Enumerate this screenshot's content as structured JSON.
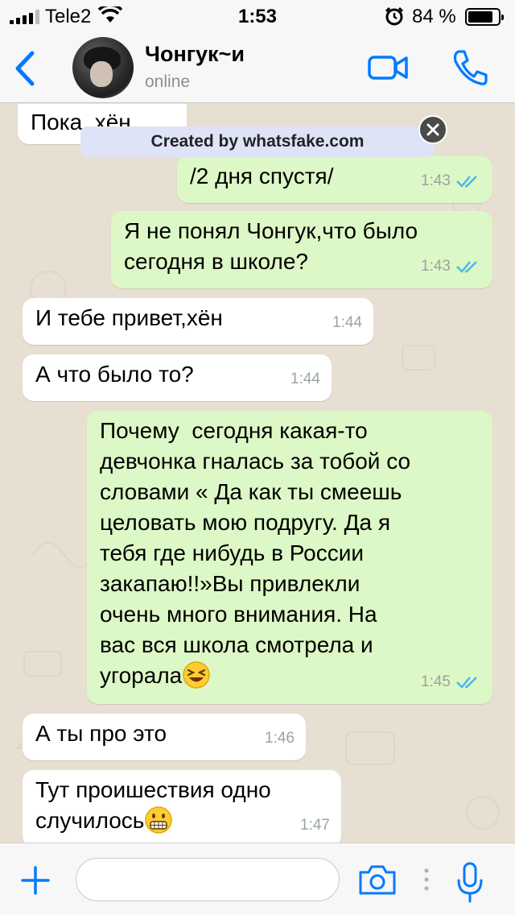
{
  "status_bar": {
    "carrier": "Tele2",
    "time": "1:53",
    "battery": "84 %",
    "battery_level": 0.84
  },
  "header": {
    "contact_name": "Чонгук~и",
    "status": "online",
    "icons": [
      "back-arrow-icon",
      "video-call-icon",
      "phone-icon"
    ]
  },
  "watermark": "Created by whatsfake.com",
  "messages": [
    {
      "dir": "in",
      "text": "Пока, хён",
      "time": ""
    },
    {
      "dir": "out",
      "text": "/2 дня спустя/",
      "time": "1:43",
      "read": true
    },
    {
      "dir": "out",
      "text": "Я не понял Чонгук,что было\nсегодня в школе?",
      "time": "1:43",
      "read": true
    },
    {
      "dir": "in",
      "text": "И тебе привет,хён",
      "time": "1:44"
    },
    {
      "dir": "in",
      "text": "А что было то?",
      "time": "1:44"
    },
    {
      "dir": "out",
      "text": "Почему  сегодня какая-то\nдевчонка гналась за тобой со\nсловами « Да как ты смеешь\nцеловать мою подругу. Да я\nтебя где нибудь в России\nзакапаю!!»Вы привлекли\nочень много внимания. На\nвас вся школа смотрела и\nугорала",
      "emoji": "laughing-emoji",
      "time": "1:45",
      "read": true
    },
    {
      "dir": "in",
      "text": "А ты про это",
      "time": "1:46"
    },
    {
      "dir": "in",
      "text": "Тут проишествия одно\nслучилось",
      "emoji": "grimacing-emoji",
      "time": "1:47"
    }
  ],
  "input": {
    "placeholder": "",
    "value": ""
  },
  "colors": {
    "accent": "#007aff",
    "outgoing_bubble": "#dcf8c6",
    "incoming_bubble": "#ffffff",
    "read_ticks": "#4fb6ec",
    "chat_background": "#e8dfd3"
  }
}
